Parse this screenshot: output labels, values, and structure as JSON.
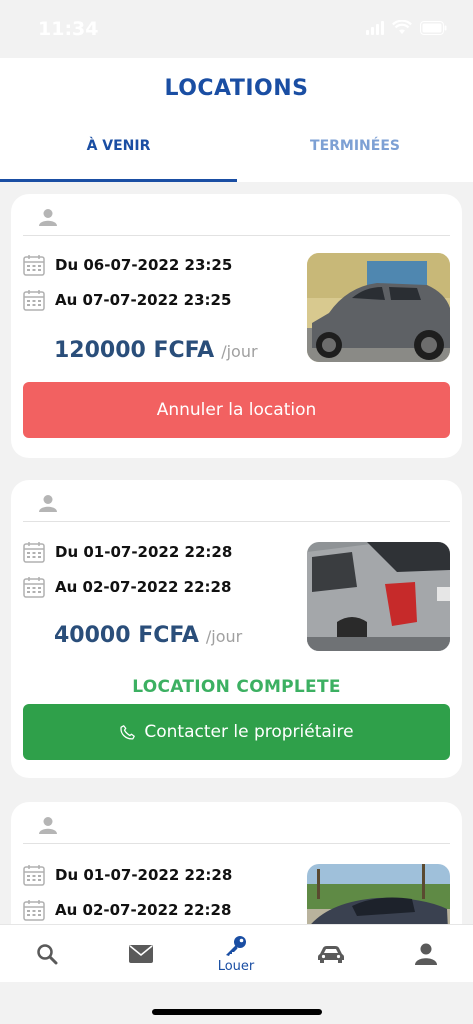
{
  "status_bar": {
    "time": "11:34"
  },
  "header": {
    "title": "LOCATIONS",
    "tabs": [
      {
        "label": "À VENIR",
        "active": true
      },
      {
        "label": "TERMINÉES",
        "active": false
      }
    ]
  },
  "rentals": [
    {
      "date_from": "Du 06-07-2022 23:25",
      "date_to": "Au 07-07-2022 23:25",
      "price": "120000 FCFA",
      "price_unit": "/jour",
      "status": "",
      "action_label": "Annuler la location",
      "action_color": "#f26161"
    },
    {
      "date_from": "Du 01-07-2022 22:28",
      "date_to": "Au 02-07-2022 22:28",
      "price": "40000 FCFA",
      "price_unit": "/jour",
      "status": "LOCATION COMPLETE",
      "action_label": "Contacter le propriétaire",
      "action_color": "#2fa04a"
    },
    {
      "date_from": "Du 01-07-2022 22:28",
      "date_to": "Au 02-07-2022 22:28"
    }
  ],
  "bottom_nav": [
    {
      "icon": "search-icon",
      "label": ""
    },
    {
      "icon": "mail-icon",
      "label": ""
    },
    {
      "icon": "key-icon",
      "label": "Louer",
      "active": true
    },
    {
      "icon": "car-icon",
      "label": ""
    },
    {
      "icon": "user-icon",
      "label": ""
    }
  ],
  "colors": {
    "primary": "#1a4ea3",
    "inactive_tab": "#7da0d4",
    "price": "#2a4e7a",
    "cancel": "#f26161",
    "contact": "#2fa04a",
    "status_complete": "#3cb062"
  }
}
